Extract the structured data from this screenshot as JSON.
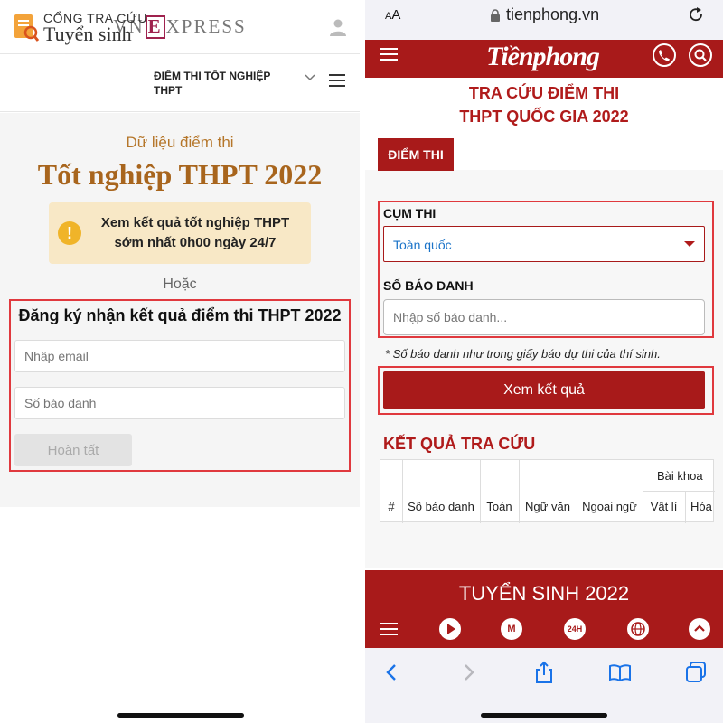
{
  "vnexpress": {
    "logo_left": "VN",
    "logo_e": "E",
    "logo_right": "XPRESS",
    "portal_line1": "CỔNG TRA CỨU",
    "portal_line2": "Tuyển sinh",
    "nav_label": "ĐIỂM THI TỐT NGHIỆP THPT",
    "subtitle": "Dữ liệu điểm thi",
    "title": "Tốt nghiệp THPT 2022",
    "alert_icon": "!",
    "alert_text": "Xem kết quả tốt nghiệp THPT sớm nhất 0h00 ngày 24/7",
    "or_text": "Hoặc",
    "form_title": "Đăng ký nhận kết quả điểm thi THPT 2022",
    "email_placeholder": "Nhập email",
    "id_placeholder": "Số báo danh",
    "submit_label": "Hoàn tất"
  },
  "tienphong": {
    "text_size_label": "AA",
    "url": "tienphong.vn",
    "logo": "Tiềnphong",
    "page_title_line1": "TRA CỨU ĐIỂM THI",
    "page_title_line2": "THPT QUỐC GIA 2022",
    "tab_label": "ĐIỂM THI",
    "cluster_label": "CỤM THI",
    "cluster_value": "Toàn quốc",
    "id_label": "SỐ BÁO DANH",
    "id_placeholder": "Nhập số báo danh...",
    "note": "* Số báo danh như trong giấy báo dự thi của thí sinh.",
    "submit_label": "Xem kết quả",
    "results_title": "KẾT QUẢ TRA CỨU",
    "table": {
      "headers": [
        "#",
        "Số báo danh",
        "Toán",
        "Ngữ văn",
        "Ngoại ngữ"
      ],
      "group_header": "Bài khoa",
      "sub_headers": [
        "Vật lí",
        "Hóa"
      ]
    },
    "banner": "TUYỂN SINH 2022",
    "bottom_nav": [
      "play-icon",
      "M",
      "24H",
      "globe-icon",
      "up-icon"
    ],
    "colors": {
      "brand": "#a81a1a",
      "highlight": "#e0393e"
    }
  }
}
